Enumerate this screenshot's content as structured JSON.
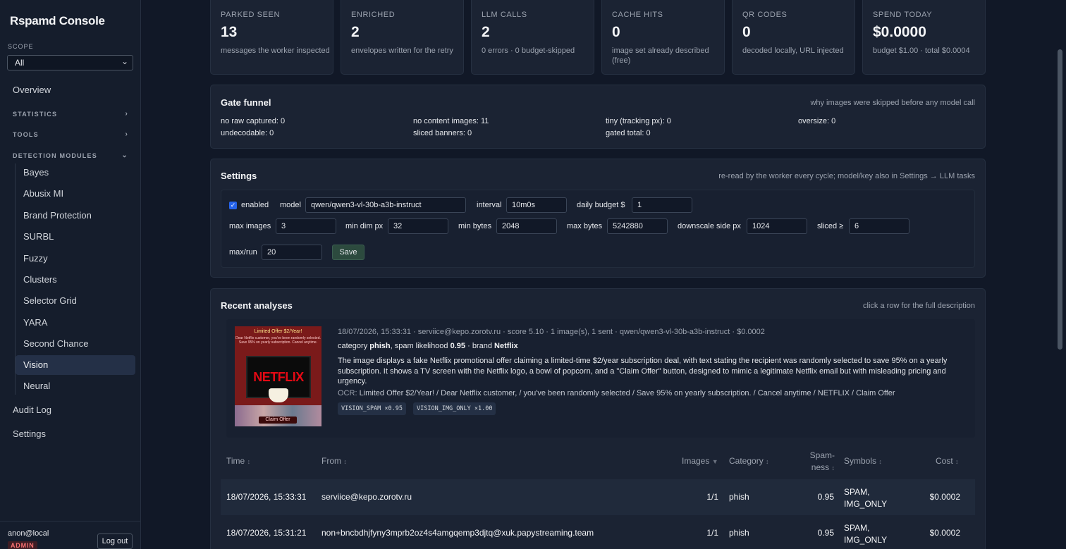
{
  "sidebar": {
    "brand": "Rspamd Console",
    "scope_label": "SCOPE",
    "scope_value": "All",
    "nav": {
      "overview": "Overview",
      "statistics": "STATISTICS",
      "tools": "TOOLS",
      "detection_modules": "DETECTION MODULES",
      "audit_log": "Audit Log",
      "settings": "Settings"
    },
    "modules": [
      "Bayes",
      "Abusix MI",
      "Brand Protection",
      "SURBL",
      "Fuzzy",
      "Clusters",
      "Selector Grid",
      "YARA",
      "Second Chance",
      "Vision",
      "Neural"
    ],
    "active_module": "Vision",
    "user": "anon@local",
    "role_badge": "ADMIN",
    "logout": "Log out"
  },
  "stats": [
    {
      "label": "PARKED SEEN",
      "value": "13",
      "desc": "messages the worker inspected"
    },
    {
      "label": "ENRICHED",
      "value": "2",
      "desc": "envelopes written for the retry"
    },
    {
      "label": "LLM CALLS",
      "value": "2",
      "desc": "0 errors · 0 budget-skipped"
    },
    {
      "label": "CACHE HITS",
      "value": "0",
      "desc": "image set already described (free)"
    },
    {
      "label": "QR CODES",
      "value": "0",
      "desc": "decoded locally, URL injected"
    },
    {
      "label": "SPEND TODAY",
      "value": "$0.0000",
      "desc": "budget $1.00 · total $0.0004"
    }
  ],
  "funnel": {
    "title": "Gate funnel",
    "hint": "why images were skipped before any model call",
    "items": [
      "no raw captured: 0",
      "no content images: 11",
      "tiny (tracking px): 0",
      "oversize: 0",
      "undecodable: 0",
      "sliced banners: 0",
      "gated total: 0"
    ]
  },
  "settings": {
    "title": "Settings",
    "hint": "re-read by the worker every cycle; model/key also in Settings → LLM tasks",
    "enabled_label": "enabled",
    "enabled": true,
    "model_label": "model",
    "model": "qwen/qwen3-vl-30b-a3b-instruct",
    "interval_label": "interval",
    "interval": "10m0s",
    "daily_budget_label": "daily budget $",
    "daily_budget": "1",
    "max_images_label": "max images",
    "max_images": "3",
    "min_dim_label": "min dim px",
    "min_dim": "32",
    "min_bytes_label": "min bytes",
    "min_bytes": "2048",
    "max_bytes_label": "max bytes",
    "max_bytes": "5242880",
    "downscale_label": "downscale side px",
    "downscale": "1024",
    "sliced_label": "sliced ≥",
    "sliced": "6",
    "max_run_label": "max/run",
    "max_run": "20",
    "save": "Save"
  },
  "recent": {
    "title": "Recent analyses",
    "hint": "click a row for the full description",
    "expanded": {
      "thumb_headline": "Limited Offer $2/Year!",
      "thumb_sub": "Dear Netflix customer, you've been randomly selected. Save 95% on yearly subscription. Cancel anytime.",
      "thumb_logo": "NETFLIX",
      "thumb_button": "Claim Offer",
      "meta": "18/07/2026, 15:33:31 · serviice@kepo.zorotv.ru · score 5.10 · 1 image(s), 1 sent · qwen/qwen3-vl-30b-a3b-instruct · $0.0002",
      "category_prefix": "category",
      "category": "phish",
      "spam_prefix": ", spam likelihood",
      "spam": "0.95",
      "brand_prefix": "· brand",
      "brand": "Netflix",
      "description": "The image displays a fake Netflix promotional offer claiming a limited-time $2/year subscription deal, with text stating the recipient was randomly selected to save 95% on a yearly subscription. It shows a TV screen with the Netflix logo, a bowl of popcorn, and a \"Claim Offer\" button, designed to mimic a legitimate Netflix email but with misleading pricing and urgency.",
      "ocr_label": "OCR:",
      "ocr": "Limited Offer $2/Year! / Dear Netflix customer, / you've been randomly selected / Save 95% on yearly subscription. / Cancel anytime / NETFLIX / Claim Offer",
      "symbols": [
        "VISION_SPAM ×0.95",
        "VISION_IMG_ONLY ×1.00"
      ]
    },
    "columns": {
      "time": "Time",
      "from": "From",
      "images": "Images",
      "category": "Category",
      "spamness_1": "Spam-",
      "spamness_2": "ness",
      "symbols": "Symbols",
      "cost": "Cost",
      "sort": "↕",
      "sort_active": "▼"
    },
    "rows": [
      {
        "time": "18/07/2026, 15:33:31",
        "from": "serviice@kepo.zorotv.ru",
        "images": "1/1",
        "category": "phish",
        "spamness": "0.95",
        "symbols_1": "SPAM,",
        "symbols_2": "IMG_ONLY",
        "cost": "$0.0002"
      },
      {
        "time": "18/07/2026, 15:31:21",
        "from": "non+bncbdhjfyny3mprb2oz4s4amgqemp3djtq@xuk.papystreaming.team",
        "images": "1/1",
        "category": "phish",
        "spamness": "0.95",
        "symbols_1": "SPAM,",
        "symbols_2": "IMG_ONLY",
        "cost": "$0.0002"
      }
    ]
  },
  "colors": {
    "background": "#111827",
    "panel": "#1b2333",
    "active_nav": "#243047",
    "save_button": "#2c4a3e",
    "admin_badge": "#f87171"
  }
}
